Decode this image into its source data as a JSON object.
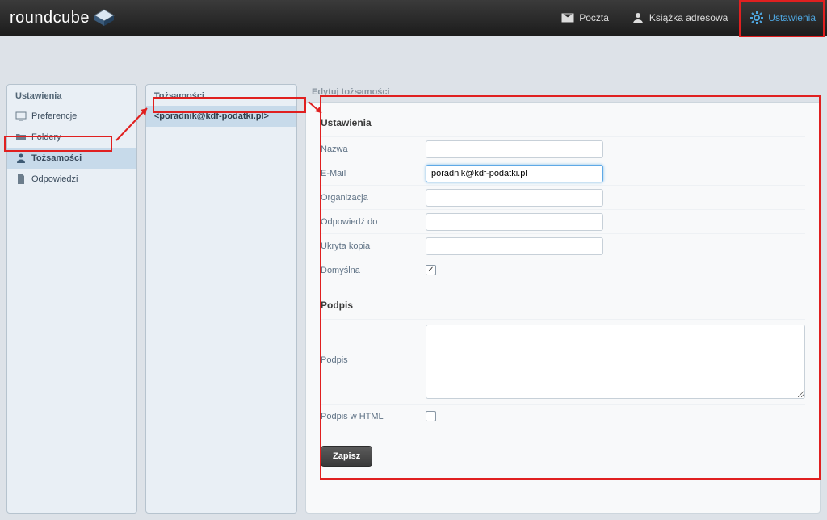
{
  "brand": "roundcube",
  "topnav": {
    "mail": "Poczta",
    "addressbook": "Książka adresowa",
    "settings": "Ustawienia"
  },
  "sidebar": {
    "title": "Ustawienia",
    "items": [
      {
        "label": "Preferencje"
      },
      {
        "label": "Foldery"
      },
      {
        "label": "Tożsamości"
      },
      {
        "label": "Odpowiedzi"
      }
    ]
  },
  "identities": {
    "title": "Tożsamości",
    "items": [
      {
        "label": "<poradnik@kdf-podatki.pl>"
      }
    ]
  },
  "editor": {
    "title": "Edytuj tożsamości",
    "section_settings": "Ustawienia",
    "fields": {
      "name_label": "Nazwa",
      "name_value": "",
      "email_label": "E-Mail",
      "email_value": "poradnik@kdf-podatki.pl",
      "org_label": "Organizacja",
      "org_value": "",
      "replyto_label": "Odpowiedź do",
      "replyto_value": "",
      "bcc_label": "Ukryta kopia",
      "bcc_value": "",
      "default_label": "Domyślna",
      "default_checked": true
    },
    "section_signature": "Podpis",
    "signature_label": "Podpis",
    "signature_value": "",
    "sig_html_label": "Podpis w HTML",
    "sig_html_checked": false,
    "save_label": "Zapisz"
  }
}
